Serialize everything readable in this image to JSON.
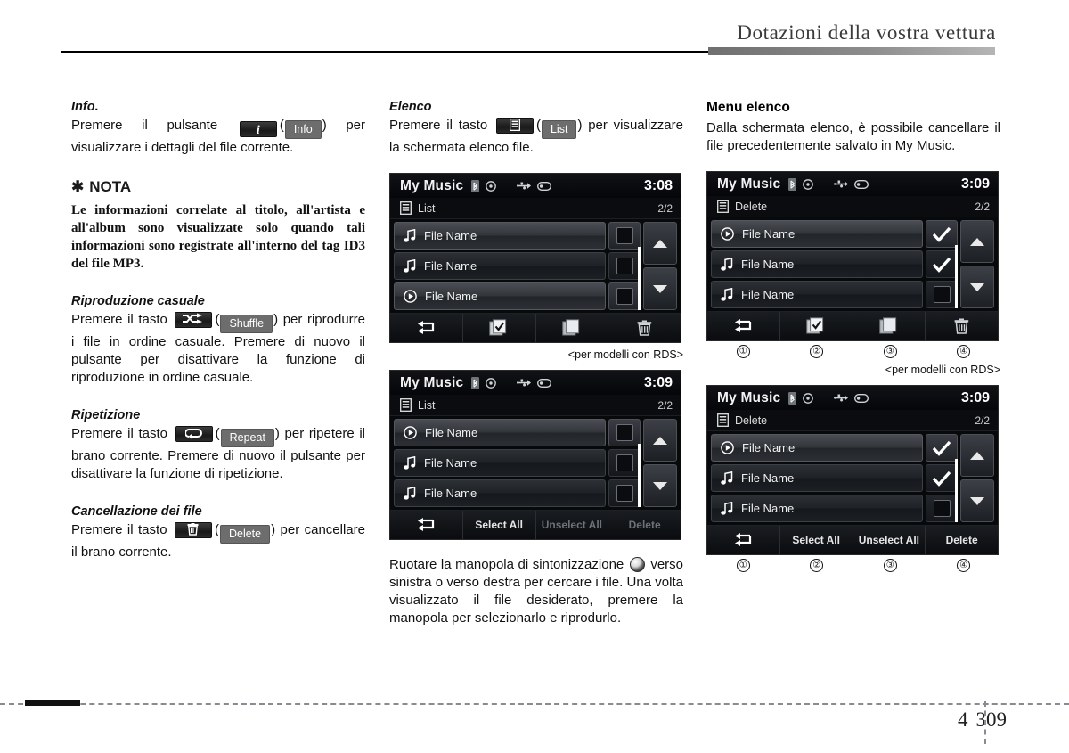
{
  "header": {
    "title": "Dotazioni della vostra vettura"
  },
  "footer": {
    "chapter": "4",
    "page": "309"
  },
  "left_column": {
    "info": {
      "heading": "Info.",
      "text_1": "Premere il pulsante",
      "key_icon": "info-i-icon",
      "key_label": "Info",
      "text_2": ") per visualizzare i dettagli del file corrente."
    },
    "note": {
      "title": "NOTA",
      "bullet": "✱",
      "body": "Le informazioni correlate al titolo, all'artista e all'album sono visualizzate solo quando tali informazioni sono registrate all'interno del tag ID3 del file MP3."
    },
    "shuffle": {
      "heading": "Riproduzione casuale",
      "text_1": "Premere il tasto",
      "key_icon": "shuffle-icon",
      "key_label": "Shuffle",
      "text_2": ") per riprodurre i file in ordine casuale. Premere di nuovo il pulsante per disattivare la funzione di riproduzione in ordine casuale."
    },
    "repeat": {
      "heading": "Ripetizione",
      "text_1": "Premere il tasto",
      "key_icon": "repeat-icon",
      "key_label": "Repeat",
      "text_2": ") per ripetere il brano corrente. Premere di nuovo il pulsante per disattivare la funzione di ripetizione."
    },
    "delete": {
      "heading": "Cancellazione dei file",
      "text_1": "Premere il tasto",
      "key_icon": "trash-icon",
      "key_label": "Delete",
      "text_2": ") per cancellare il brano corrente."
    }
  },
  "mid_column": {
    "list": {
      "heading": "Elenco",
      "text_1": "Premere il tasto",
      "key_icon": "list-icon",
      "key_label": "List",
      "text_2": ") per visualizzare la schermata elenco file."
    },
    "screen_1": {
      "title": "My Music",
      "clock": "3:08",
      "menu_label": "List",
      "page_indicator": "2/2",
      "rows": [
        {
          "label": "File Name",
          "icon": "music-note-icon",
          "highlighted": true,
          "checked": false
        },
        {
          "label": "File Name",
          "icon": "music-note-icon",
          "highlighted": false,
          "checked": false
        },
        {
          "label": "File Name",
          "icon": "play-circle-icon",
          "highlighted": true,
          "checked": false
        }
      ],
      "footer_buttons": [
        {
          "label": "",
          "icon": "back-arrow-icon"
        },
        {
          "label": "",
          "icon": "checked-pages-icon"
        },
        {
          "label": "",
          "icon": "blank-pages-icon"
        },
        {
          "label": "",
          "icon": "trash-icon"
        }
      ]
    },
    "caption_1": "<per modelli con RDS>",
    "screen_2": {
      "title": "My Music",
      "clock": "3:09",
      "menu_label": "List",
      "page_indicator": "2/2",
      "rows": [
        {
          "label": "File Name",
          "icon": "play-circle-icon",
          "highlighted": true,
          "checked": false
        },
        {
          "label": "File Name",
          "icon": "music-note-icon",
          "highlighted": false,
          "checked": false
        },
        {
          "label": "File Name",
          "icon": "music-note-icon",
          "highlighted": false,
          "checked": false
        }
      ],
      "footer_buttons": [
        {
          "label": "",
          "icon": "back-arrow-icon",
          "disabled": false
        },
        {
          "label": "Select All",
          "icon": "",
          "disabled": false
        },
        {
          "label": "Unselect All",
          "icon": "",
          "disabled": true
        },
        {
          "label": "Delete",
          "icon": "",
          "disabled": true
        }
      ]
    },
    "knob_text": {
      "part_1": "Ruotare la manopola di sintonizzazione",
      "icon": "tuning-knob-icon",
      "part_2": "verso sinistra o verso destra per cercare i file. Una volta visualizzato il file desiderato, premere la manopola per selezionarlo e riprodurlo."
    }
  },
  "right_column": {
    "menu": {
      "heading": "Menu elenco",
      "body": "Dalla schermata elenco, è possibile cancellare il file precedentemente salvato in My Music."
    },
    "screen_3": {
      "title": "My Music",
      "clock": "3:09",
      "menu_label": "Delete",
      "page_indicator": "2/2",
      "rows": [
        {
          "label": "File Name",
          "icon": "play-circle-icon",
          "highlighted": true,
          "checked": true
        },
        {
          "label": "File Name",
          "icon": "music-note-icon",
          "highlighted": false,
          "checked": true
        },
        {
          "label": "File Name",
          "icon": "music-note-icon",
          "highlighted": false,
          "checked": false
        }
      ],
      "footer_buttons": [
        {
          "label": "",
          "icon": "back-arrow-icon"
        },
        {
          "label": "",
          "icon": "checked-pages-icon"
        },
        {
          "label": "",
          "icon": "blank-pages-icon"
        },
        {
          "label": "",
          "icon": "trash-icon"
        }
      ],
      "callouts": [
        "①",
        "②",
        "③",
        "④"
      ]
    },
    "caption_2": "<per modelli con RDS>",
    "screen_4": {
      "title": "My Music",
      "clock": "3:09",
      "menu_label": "Delete",
      "page_indicator": "2/2",
      "rows": [
        {
          "label": "File Name",
          "icon": "play-circle-icon",
          "highlighted": true,
          "checked": true
        },
        {
          "label": "File Name",
          "icon": "music-note-icon",
          "highlighted": false,
          "checked": true
        },
        {
          "label": "File Name",
          "icon": "music-note-icon",
          "highlighted": false,
          "checked": false
        }
      ],
      "footer_buttons": [
        {
          "label": "",
          "icon": "back-arrow-icon",
          "disabled": false
        },
        {
          "label": "Select All",
          "icon": "",
          "disabled": false
        },
        {
          "label": "Unselect All",
          "icon": "",
          "disabled": false
        },
        {
          "label": "Delete",
          "icon": "",
          "disabled": false
        }
      ],
      "callouts": [
        "①",
        "②",
        "③",
        "④"
      ]
    }
  },
  "status_icons": [
    "bluetooth-icon",
    "disc-icon",
    "usb-icon",
    "ipod-icon"
  ]
}
